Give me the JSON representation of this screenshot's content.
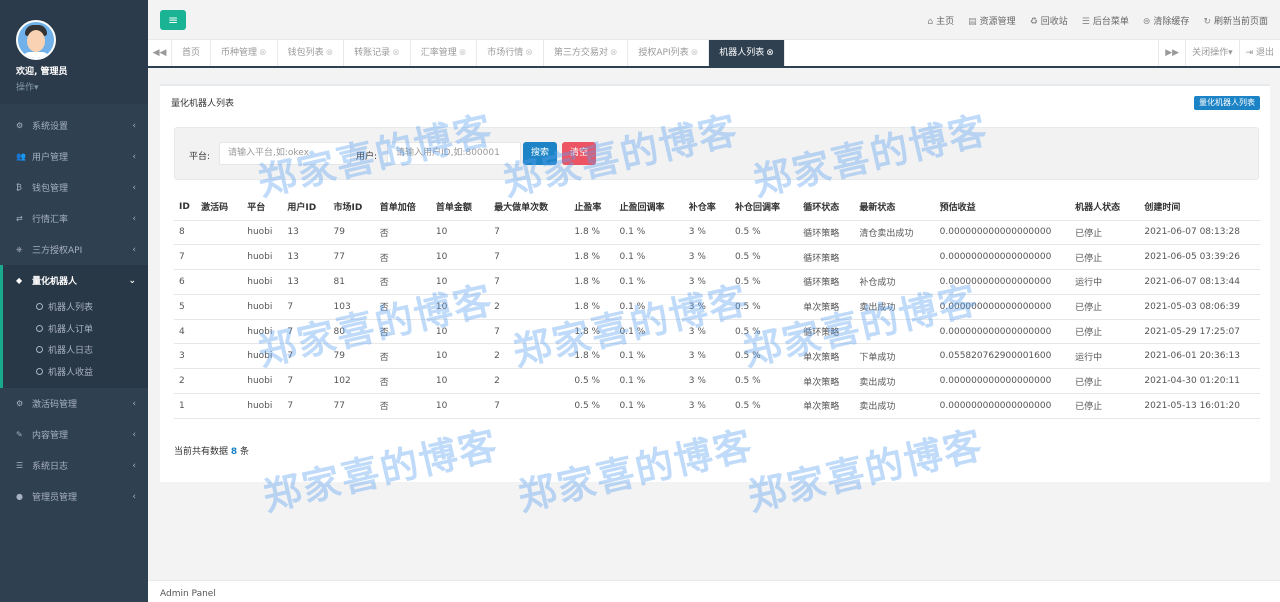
{
  "sidebar": {
    "welcome": "欢迎, 管理员",
    "ops": "操作▾",
    "items": [
      {
        "icon": "⚙",
        "label": "系统设置",
        "arrow": "‹"
      },
      {
        "icon": "👥",
        "label": "用户管理",
        "arrow": "‹"
      },
      {
        "icon": "₿",
        "label": "钱包管理",
        "arrow": "‹"
      },
      {
        "icon": "⇄",
        "label": "行情汇率",
        "arrow": "‹"
      },
      {
        "icon": "⎈",
        "label": "三方授权API",
        "arrow": "‹"
      },
      {
        "icon": "◆",
        "label": "量化机器人",
        "arrow": "⌄"
      },
      {
        "icon": "⚙",
        "label": "激活码管理",
        "arrow": "‹"
      },
      {
        "icon": "✎",
        "label": "内容管理",
        "arrow": "‹"
      },
      {
        "icon": "☰",
        "label": "系统日志",
        "arrow": "‹"
      },
      {
        "icon": "●",
        "label": "管理员管理",
        "arrow": "‹"
      }
    ],
    "sub_items": [
      "机器人列表",
      "机器人订单",
      "机器人日志",
      "机器人收益"
    ]
  },
  "topbar": {
    "menu_icon": "≡",
    "links": [
      {
        "icon": "⌂",
        "label": "主页"
      },
      {
        "icon": "▤",
        "label": "资源管理"
      },
      {
        "icon": "♻",
        "label": "回收站"
      },
      {
        "icon": "☰",
        "label": "后台菜单"
      },
      {
        "icon": "⊜",
        "label": "清除缓存"
      },
      {
        "icon": "↻",
        "label": "刷新当前页面"
      }
    ]
  },
  "tabs": {
    "prev": "◀◀",
    "next": "▶▶",
    "close_ops": "关闭操作▾",
    "logout": "⇥ 退出",
    "items": [
      {
        "label": "首页",
        "x": ""
      },
      {
        "label": "币种管理",
        "x": "⊗"
      },
      {
        "label": "钱包列表",
        "x": "⊗"
      },
      {
        "label": "转账记录",
        "x": "⊗"
      },
      {
        "label": "汇率管理",
        "x": "⊗"
      },
      {
        "label": "市场行情",
        "x": "⊗"
      },
      {
        "label": "第三方交易对",
        "x": "⊗"
      },
      {
        "label": "授权API列表",
        "x": "⊗"
      },
      {
        "label": "机器人列表",
        "x": "⊗"
      }
    ]
  },
  "content": {
    "title": "量化机器人列表",
    "title_button": "量化机器人列表",
    "search": {
      "platform_label": "平台:",
      "platform_placeholder": "请输入平台,如:okex",
      "user_label": "用户:",
      "user_placeholder": "请输入用户ID,如:800001",
      "search_button": "搜索",
      "clear_button": "清空"
    },
    "columns": [
      "ID",
      "激活码",
      "平台",
      "用户ID",
      "市场ID",
      "首单加倍",
      "首单金额",
      "最大做单次数",
      "止盈率",
      "止盈回调率",
      "补仓率",
      "补仓回调率",
      "循环状态",
      "最新状态",
      "预估收益",
      "机器人状态",
      "创建时间"
    ],
    "rows": [
      [
        "8",
        "",
        "huobi",
        "13",
        "79",
        "否",
        "10",
        "7",
        "1.8 %",
        "0.1 %",
        "3 %",
        "0.5 %",
        "循环策略",
        "清仓卖出成功",
        "0.000000000000000000",
        "已停止",
        "2021-06-07 08:13:28"
      ],
      [
        "7",
        "",
        "huobi",
        "13",
        "77",
        "否",
        "10",
        "7",
        "1.8 %",
        "0.1 %",
        "3 %",
        "0.5 %",
        "循环策略",
        "",
        "0.000000000000000000",
        "已停止",
        "2021-06-05 03:39:26"
      ],
      [
        "6",
        "",
        "huobi",
        "13",
        "81",
        "否",
        "10",
        "7",
        "1.8 %",
        "0.1 %",
        "3 %",
        "0.5 %",
        "循环策略",
        "补仓成功",
        "0.000000000000000000",
        "运行中",
        "2021-06-07 08:13:44"
      ],
      [
        "5",
        "",
        "huobi",
        "7",
        "103",
        "否",
        "10",
        "2",
        "1.8 %",
        "0.1 %",
        "3 %",
        "0.5 %",
        "单次策略",
        "卖出成功",
        "0.000000000000000000",
        "已停止",
        "2021-05-03 08:06:39"
      ],
      [
        "4",
        "",
        "huobi",
        "7",
        "80",
        "否",
        "10",
        "7",
        "1.8 %",
        "0.1 %",
        "3 %",
        "0.5 %",
        "循环策略",
        "",
        "0.000000000000000000",
        "已停止",
        "2021-05-29 17:25:07"
      ],
      [
        "3",
        "",
        "huobi",
        "7",
        "79",
        "否",
        "10",
        "2",
        "1.8 %",
        "0.1 %",
        "3 %",
        "0.5 %",
        "单次策略",
        "下单成功",
        "0.055820762900001600",
        "运行中",
        "2021-06-01 20:36:13"
      ],
      [
        "2",
        "",
        "huobi",
        "7",
        "102",
        "否",
        "10",
        "2",
        "0.5 %",
        "0.1 %",
        "3 %",
        "0.5 %",
        "单次策略",
        "卖出成功",
        "0.000000000000000000",
        "已停止",
        "2021-04-30 01:20:11"
      ],
      [
        "1",
        "",
        "huobi",
        "7",
        "77",
        "否",
        "10",
        "7",
        "0.5 %",
        "0.1 %",
        "3 %",
        "0.5 %",
        "单次策略",
        "卖出成功",
        "0.000000000000000000",
        "已停止",
        "2021-05-13 16:01:20"
      ]
    ],
    "count_prefix": "当前共有数据",
    "count_value": "8",
    "count_suffix": "条"
  },
  "footer": "Admin Panel",
  "watermark": "郑家喜的博客",
  "colors": {
    "sidebar": "#2f4050",
    "accent": "#1ab394",
    "primary": "#1c84c6",
    "danger": "#ed5565"
  }
}
